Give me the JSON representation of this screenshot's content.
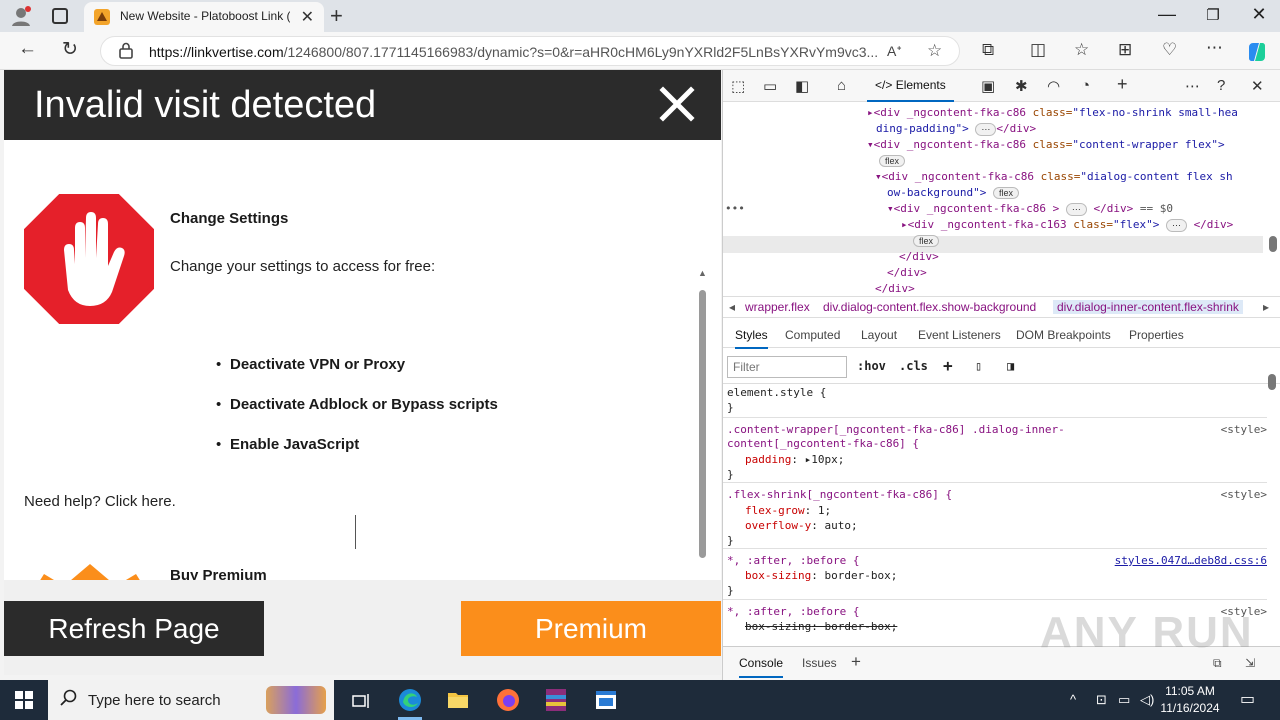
{
  "browser": {
    "tab_title": "New Website - Platoboost Link (",
    "url_host": "https://linkvertise.com",
    "url_path": "/1246800/807.1771145166983/dynamic?s=0&r=aHR0cHM6Ly9nYXRld2F5LnBsYXRvYm9vc3...",
    "new_tab": "+",
    "tab_close": "✕"
  },
  "dialog": {
    "title": "Invalid visit detected",
    "change_heading": "Change Settings",
    "change_text": "Change your settings to access for free:",
    "bullets": [
      "Deactivate VPN or Proxy",
      "Deactivate Adblock or Bypass scripts",
      "Enable JavaScript"
    ],
    "help": "Need help? Click here.",
    "premium_heading": "Buy Premium",
    "refresh_label": "Refresh Page",
    "premium_label": "Premium"
  },
  "devtools": {
    "elements_tab": "Elements",
    "dom": {
      "l1_tag": "<div _ngcontent-fka-c86 ",
      "l1_attr": "class=",
      "l1_val": "\"flex-no-shrink small-hea",
      "l1b": "ding-padding\">",
      "l1c": "</div>",
      "l2_tag": "<div _ngcontent-fka-c86 ",
      "l2_attr": "class=",
      "l2_val": "\"content-wrapper flex\">",
      "l3_tag": "<div _ngcontent-fka-c86 ",
      "l3_attr": "class=",
      "l3_val": "\"dialog-content flex sh",
      "l3b": "ow-background\">",
      "l4_tag": "<div _ngcontent-fka-c86 ",
      "l4_rest": "</div>",
      "l4_eq": "== $0",
      "l5_tag": "<div _ngcontent-fka-c163 ",
      "l5_attr": "class=",
      "l5_val": "\"flex\">",
      "l5_end": "</div>",
      "close1": "</div>",
      "close2": "</div>",
      "close3": "</div>",
      "badge": "flex",
      "ellipsis": "⋯"
    },
    "crumbs": [
      "wrapper.flex",
      "div.dialog-content.flex.show-background",
      "div.dialog-inner-content.flex-shrink"
    ],
    "sub_tabs": [
      "Styles",
      "Computed",
      "Layout",
      "Event Listeners",
      "DOM Breakpoints",
      "Properties"
    ],
    "filter_placeholder": "Filter",
    "hov": ":hov",
    "cls": ".cls",
    "styles": {
      "r1_sel": "element.style {",
      "r1_close": "}",
      "r2_sel_a": ".content-wrapper[_ngcontent-fka-c86] .dialog-inner-",
      "r2_sel_b": "content[_ngcontent-fka-c86] {",
      "r2_src": "<style>",
      "r2_prop": "padding",
      "r2_val": "10px;",
      "r2_close": "}",
      "r3_sel": ".flex-shrink[_ngcontent-fka-c86] {",
      "r3_src": "<style>",
      "r3_p1": "flex-grow",
      "r3_v1": "1;",
      "r3_p2": "overflow-y",
      "r3_v2": "auto;",
      "r3_close": "}",
      "r4_sel": "*, :after, :before {",
      "r4_src": "styles.047d…deb8d.css:6",
      "r4_p1": "box-sizing",
      "r4_v1": "border-box;",
      "r4_close": "}",
      "r5_sel": "*, :after, :before {",
      "r5_src": "<style>",
      "r5_p1": "box-sizing",
      "r5_v1": "border-box;"
    },
    "drawer": [
      "Console",
      "Issues"
    ]
  },
  "watermark": "ANY RUN",
  "taskbar": {
    "search_placeholder": "Type here to search",
    "time": "11:05 AM",
    "date": "11/16/2024"
  },
  "colors": {
    "premium": "#fb8e1b",
    "dark": "#2b2b2b",
    "stop_red": "#e5202a"
  }
}
